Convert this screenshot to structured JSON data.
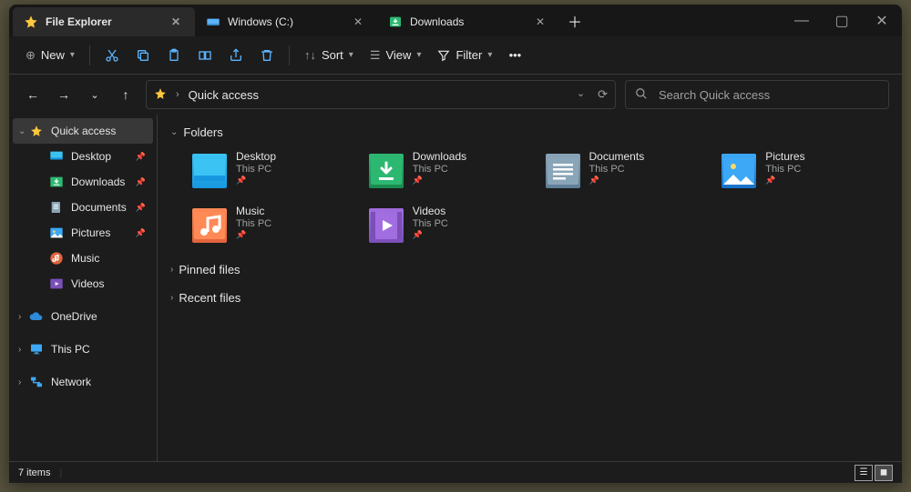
{
  "window": {
    "title": "File Explorer"
  },
  "tabs": [
    {
      "label": "File Explorer",
      "icon": "star-icon",
      "active": true
    },
    {
      "label": "Windows (C:)",
      "icon": "drive-icon",
      "active": false
    },
    {
      "label": "Downloads",
      "icon": "download-icon",
      "active": false
    }
  ],
  "toolbar": {
    "new_label": "New",
    "sort_label": "Sort",
    "view_label": "View",
    "filter_label": "Filter"
  },
  "address": {
    "location": "Quick access"
  },
  "search": {
    "placeholder": "Search Quick access"
  },
  "sidebar": {
    "quick_access": "Quick access",
    "pinned": [
      {
        "label": "Desktop",
        "icon": "desktop"
      },
      {
        "label": "Downloads",
        "icon": "downloads"
      },
      {
        "label": "Documents",
        "icon": "documents"
      },
      {
        "label": "Pictures",
        "icon": "pictures"
      },
      {
        "label": "Music",
        "icon": "music"
      },
      {
        "label": "Videos",
        "icon": "videos"
      }
    ],
    "onedrive": "OneDrive",
    "thispc": "This PC",
    "network": "Network"
  },
  "sections": {
    "folders_header": "Folders",
    "pinned_header": "Pinned files",
    "recent_header": "Recent files",
    "folders": [
      {
        "name": "Desktop",
        "loc": "This PC",
        "icon": "desktop"
      },
      {
        "name": "Downloads",
        "loc": "This PC",
        "icon": "downloads"
      },
      {
        "name": "Documents",
        "loc": "This PC",
        "icon": "documents"
      },
      {
        "name": "Pictures",
        "loc": "This PC",
        "icon": "pictures"
      },
      {
        "name": "Music",
        "loc": "This PC",
        "icon": "music"
      },
      {
        "name": "Videos",
        "loc": "This PC",
        "icon": "videos"
      }
    ]
  },
  "status": {
    "items_count": "7 items"
  }
}
